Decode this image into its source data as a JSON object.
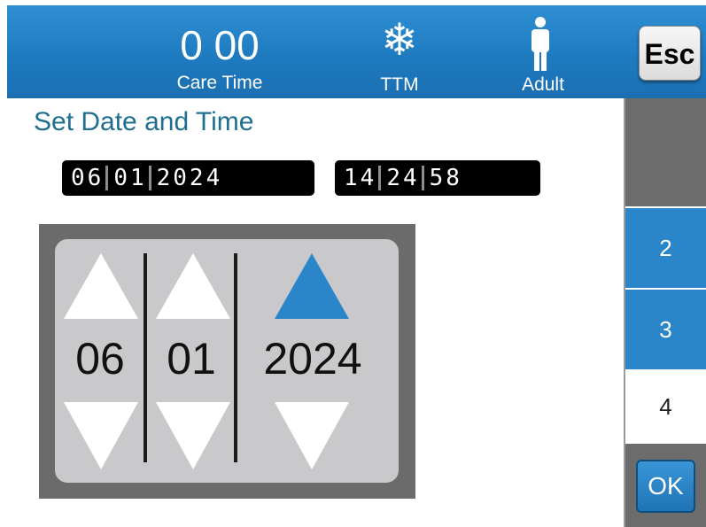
{
  "header": {
    "care_time_value": "0 00",
    "care_time_label": "Care Time",
    "ttm_icon": "snowflake-icon",
    "ttm_label": "TTM",
    "patient_icon": "adult-person-icon",
    "patient_label": "Adult",
    "esc_label": "Esc"
  },
  "panel": {
    "title": "Set Date and Time",
    "date_readout": {
      "month": "06",
      "day": "01",
      "year": "2024"
    },
    "time_readout": {
      "hour": "14",
      "minute": "24",
      "second": "58"
    }
  },
  "spinner": {
    "month": "06",
    "day": "01",
    "year": "2024",
    "active_column": "year"
  },
  "sidebar": {
    "step2": "2",
    "step3": "3",
    "step4": "4",
    "ok_label": "OK"
  },
  "colors": {
    "header_blue": "#1f7bc0",
    "accent_blue": "#2a86c9",
    "title_teal": "#1f6f91",
    "frame_gray": "#6b6b6b",
    "spinner_bg": "#c9c9cb"
  }
}
